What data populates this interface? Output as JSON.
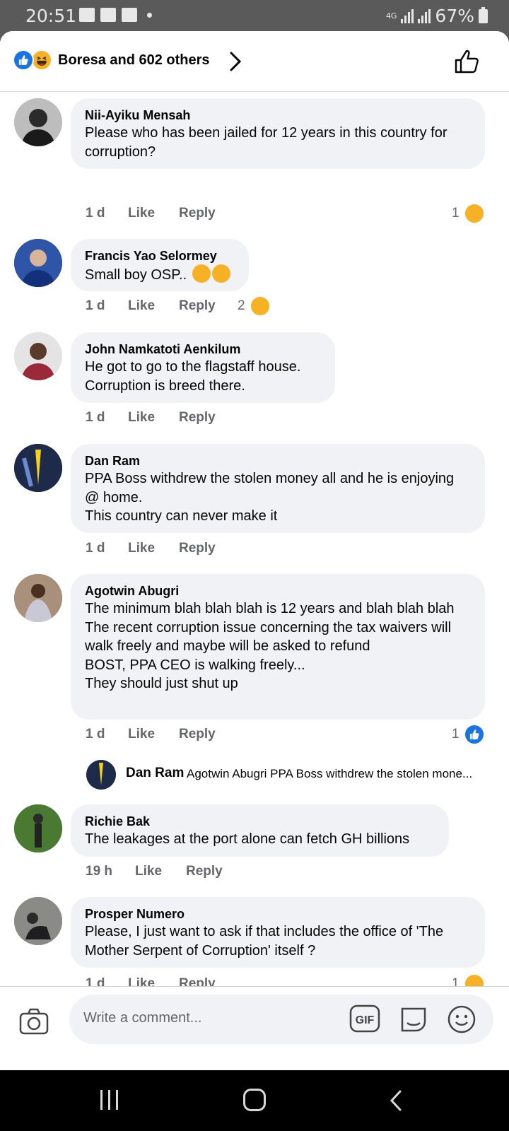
{
  "status_bar": {
    "time": "20:51",
    "network": "4G",
    "battery": "67%"
  },
  "header": {
    "reactions_text": "Boresa and 602 others"
  },
  "comments": [
    {
      "name": "Nii-Ayiku Mensah",
      "text": "Please who has been jailed for 12 years in this country for corruption?",
      "time": "1 d",
      "like": "Like",
      "reply": "Reply",
      "reaction_count": "1",
      "reaction_type": "haha"
    },
    {
      "name": "Francis Yao Selormey",
      "text": "Small boy OSP..",
      "time": "1 d",
      "like": "Like",
      "reply": "Reply",
      "reaction_count": "2",
      "reaction_type": "haha"
    },
    {
      "name": "John Namkatoti Aenkilum",
      "text": "He got to go to the flagstaff house.\nCorruption is breed there.",
      "time": "1 d",
      "like": "Like",
      "reply": "Reply"
    },
    {
      "name": "Dan Ram",
      "text": "PPA Boss withdrew the stolen money all and he is enjoying @ home.\nThis country can never make it",
      "time": "1 d",
      "like": "Like",
      "reply": "Reply"
    },
    {
      "name": "Agotwin Abugri",
      "text": "The minimum blah blah blah is 12 years and blah blah blah\nThe recent corruption issue concerning the tax waivers will walk freely and maybe will be asked to refund\nBOST, PPA CEO is walking freely...\nThey should just shut up",
      "time": "1 d",
      "like": "Like",
      "reply": "Reply",
      "reaction_count": "1",
      "reaction_type": "like"
    },
    {
      "name": "Richie Bak",
      "text": "The leakages at the port alone can fetch GH billions",
      "time": "19 h",
      "like": "Like",
      "reply": "Reply"
    },
    {
      "name": "Prosper Numero",
      "text": "Please, I just want to ask if that includes the office of 'The Mother Serpent of Corruption' itself ?",
      "time": "1 d",
      "like": "Like",
      "reply": "Reply",
      "reaction_count": "1",
      "reaction_type": "haha"
    }
  ],
  "reply_preview": {
    "name": "Dan Ram",
    "text": "Agotwin Abugri PPA Boss withdrew the stolen mone..."
  },
  "composer": {
    "placeholder": "Write a comment...",
    "gif_label": "GIF"
  },
  "colors": {
    "accent": "#1b74e4",
    "haha": "#f7b125",
    "bubble": "#f0f2f5",
    "meta": "#65676b"
  }
}
